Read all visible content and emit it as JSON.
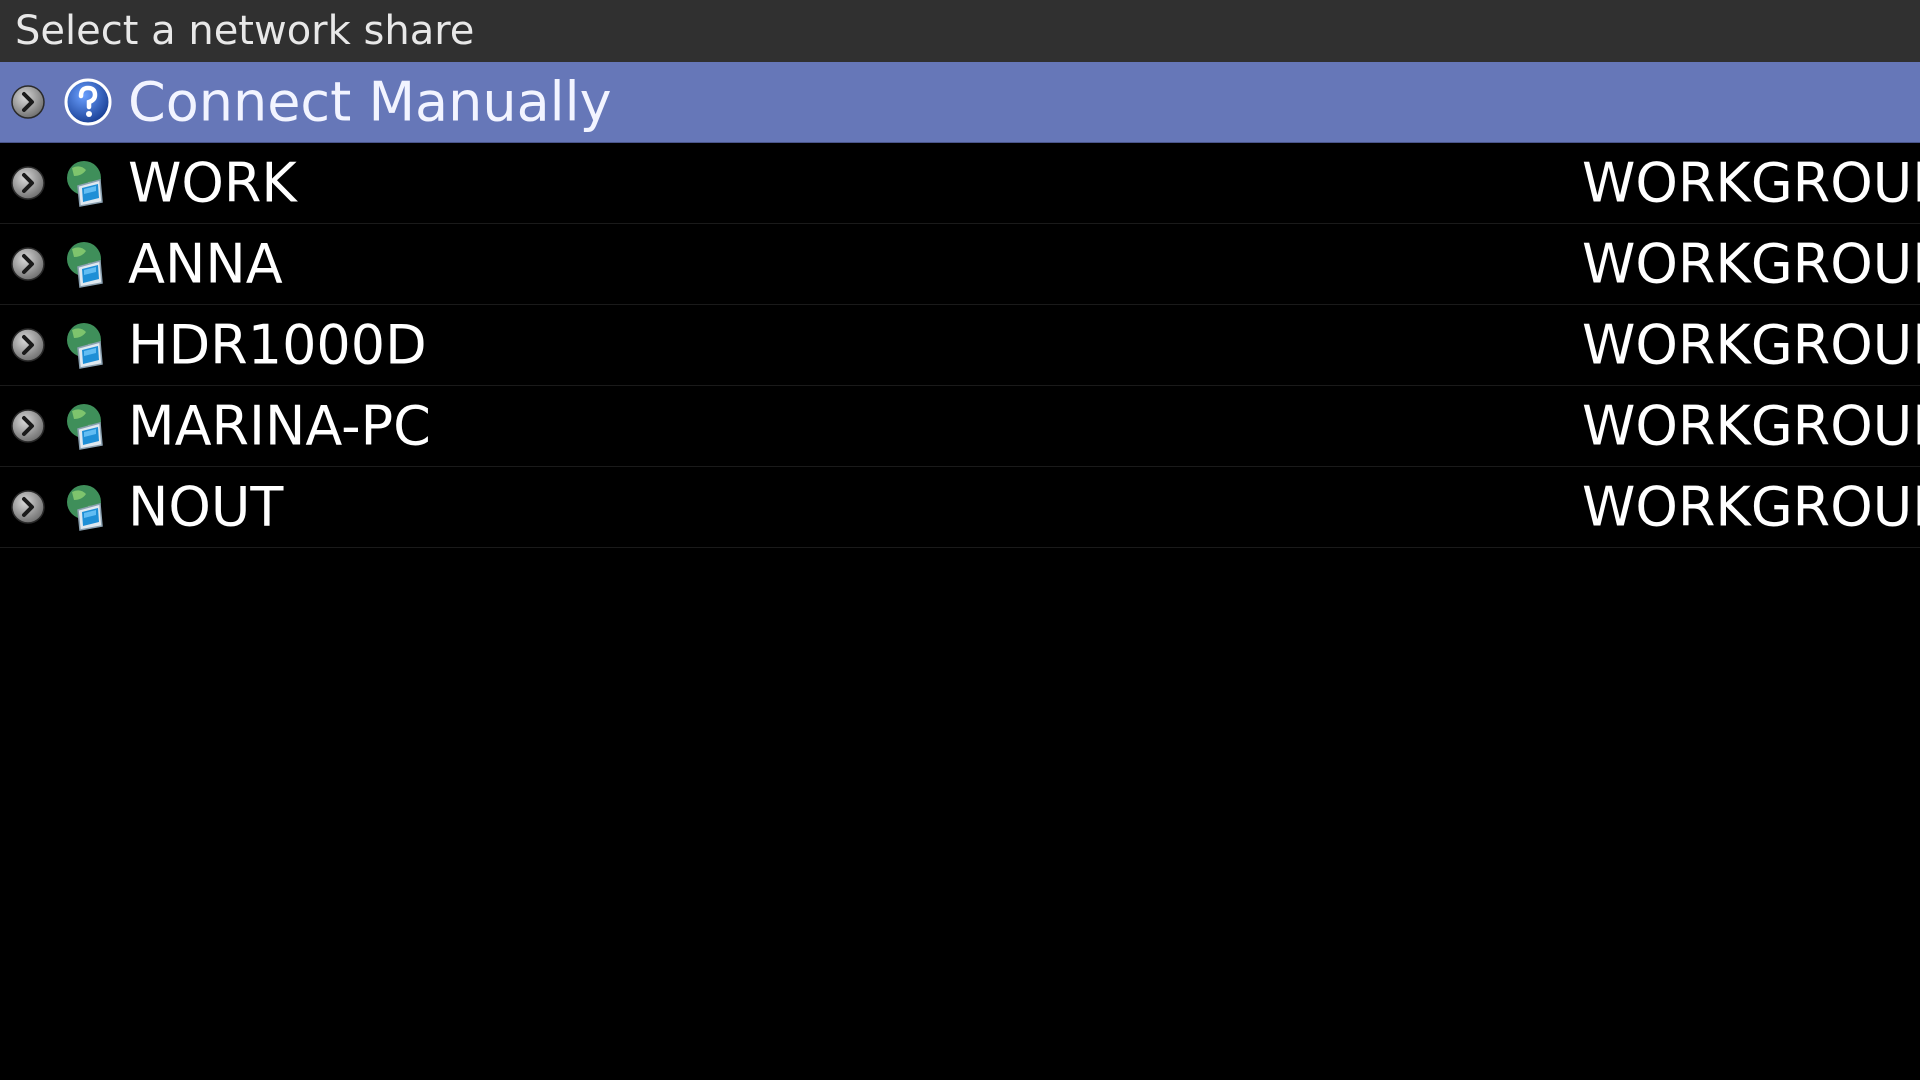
{
  "header": {
    "title": "Select a network share"
  },
  "list": {
    "items": [
      {
        "label": "Connect Manually",
        "group": "",
        "icon": "help-question-icon",
        "selected": true
      },
      {
        "label": "WORK",
        "group": "WORKGROUP",
        "icon": "network-computer-icon",
        "selected": false
      },
      {
        "label": "ANNA",
        "group": "WORKGROUP",
        "icon": "network-computer-icon",
        "selected": false
      },
      {
        "label": "HDR1000D",
        "group": "WORKGROUP",
        "icon": "network-computer-icon",
        "selected": false
      },
      {
        "label": "MARINA-PC",
        "group": "WORKGROUP",
        "icon": "network-computer-icon",
        "selected": false
      },
      {
        "label": "NOUT",
        "group": "WORKGROUP",
        "icon": "network-computer-icon",
        "selected": false
      }
    ]
  },
  "colors": {
    "background": "#000000",
    "title_bar": "#303030",
    "selection": "#6677b8",
    "text": "#ffffff"
  }
}
